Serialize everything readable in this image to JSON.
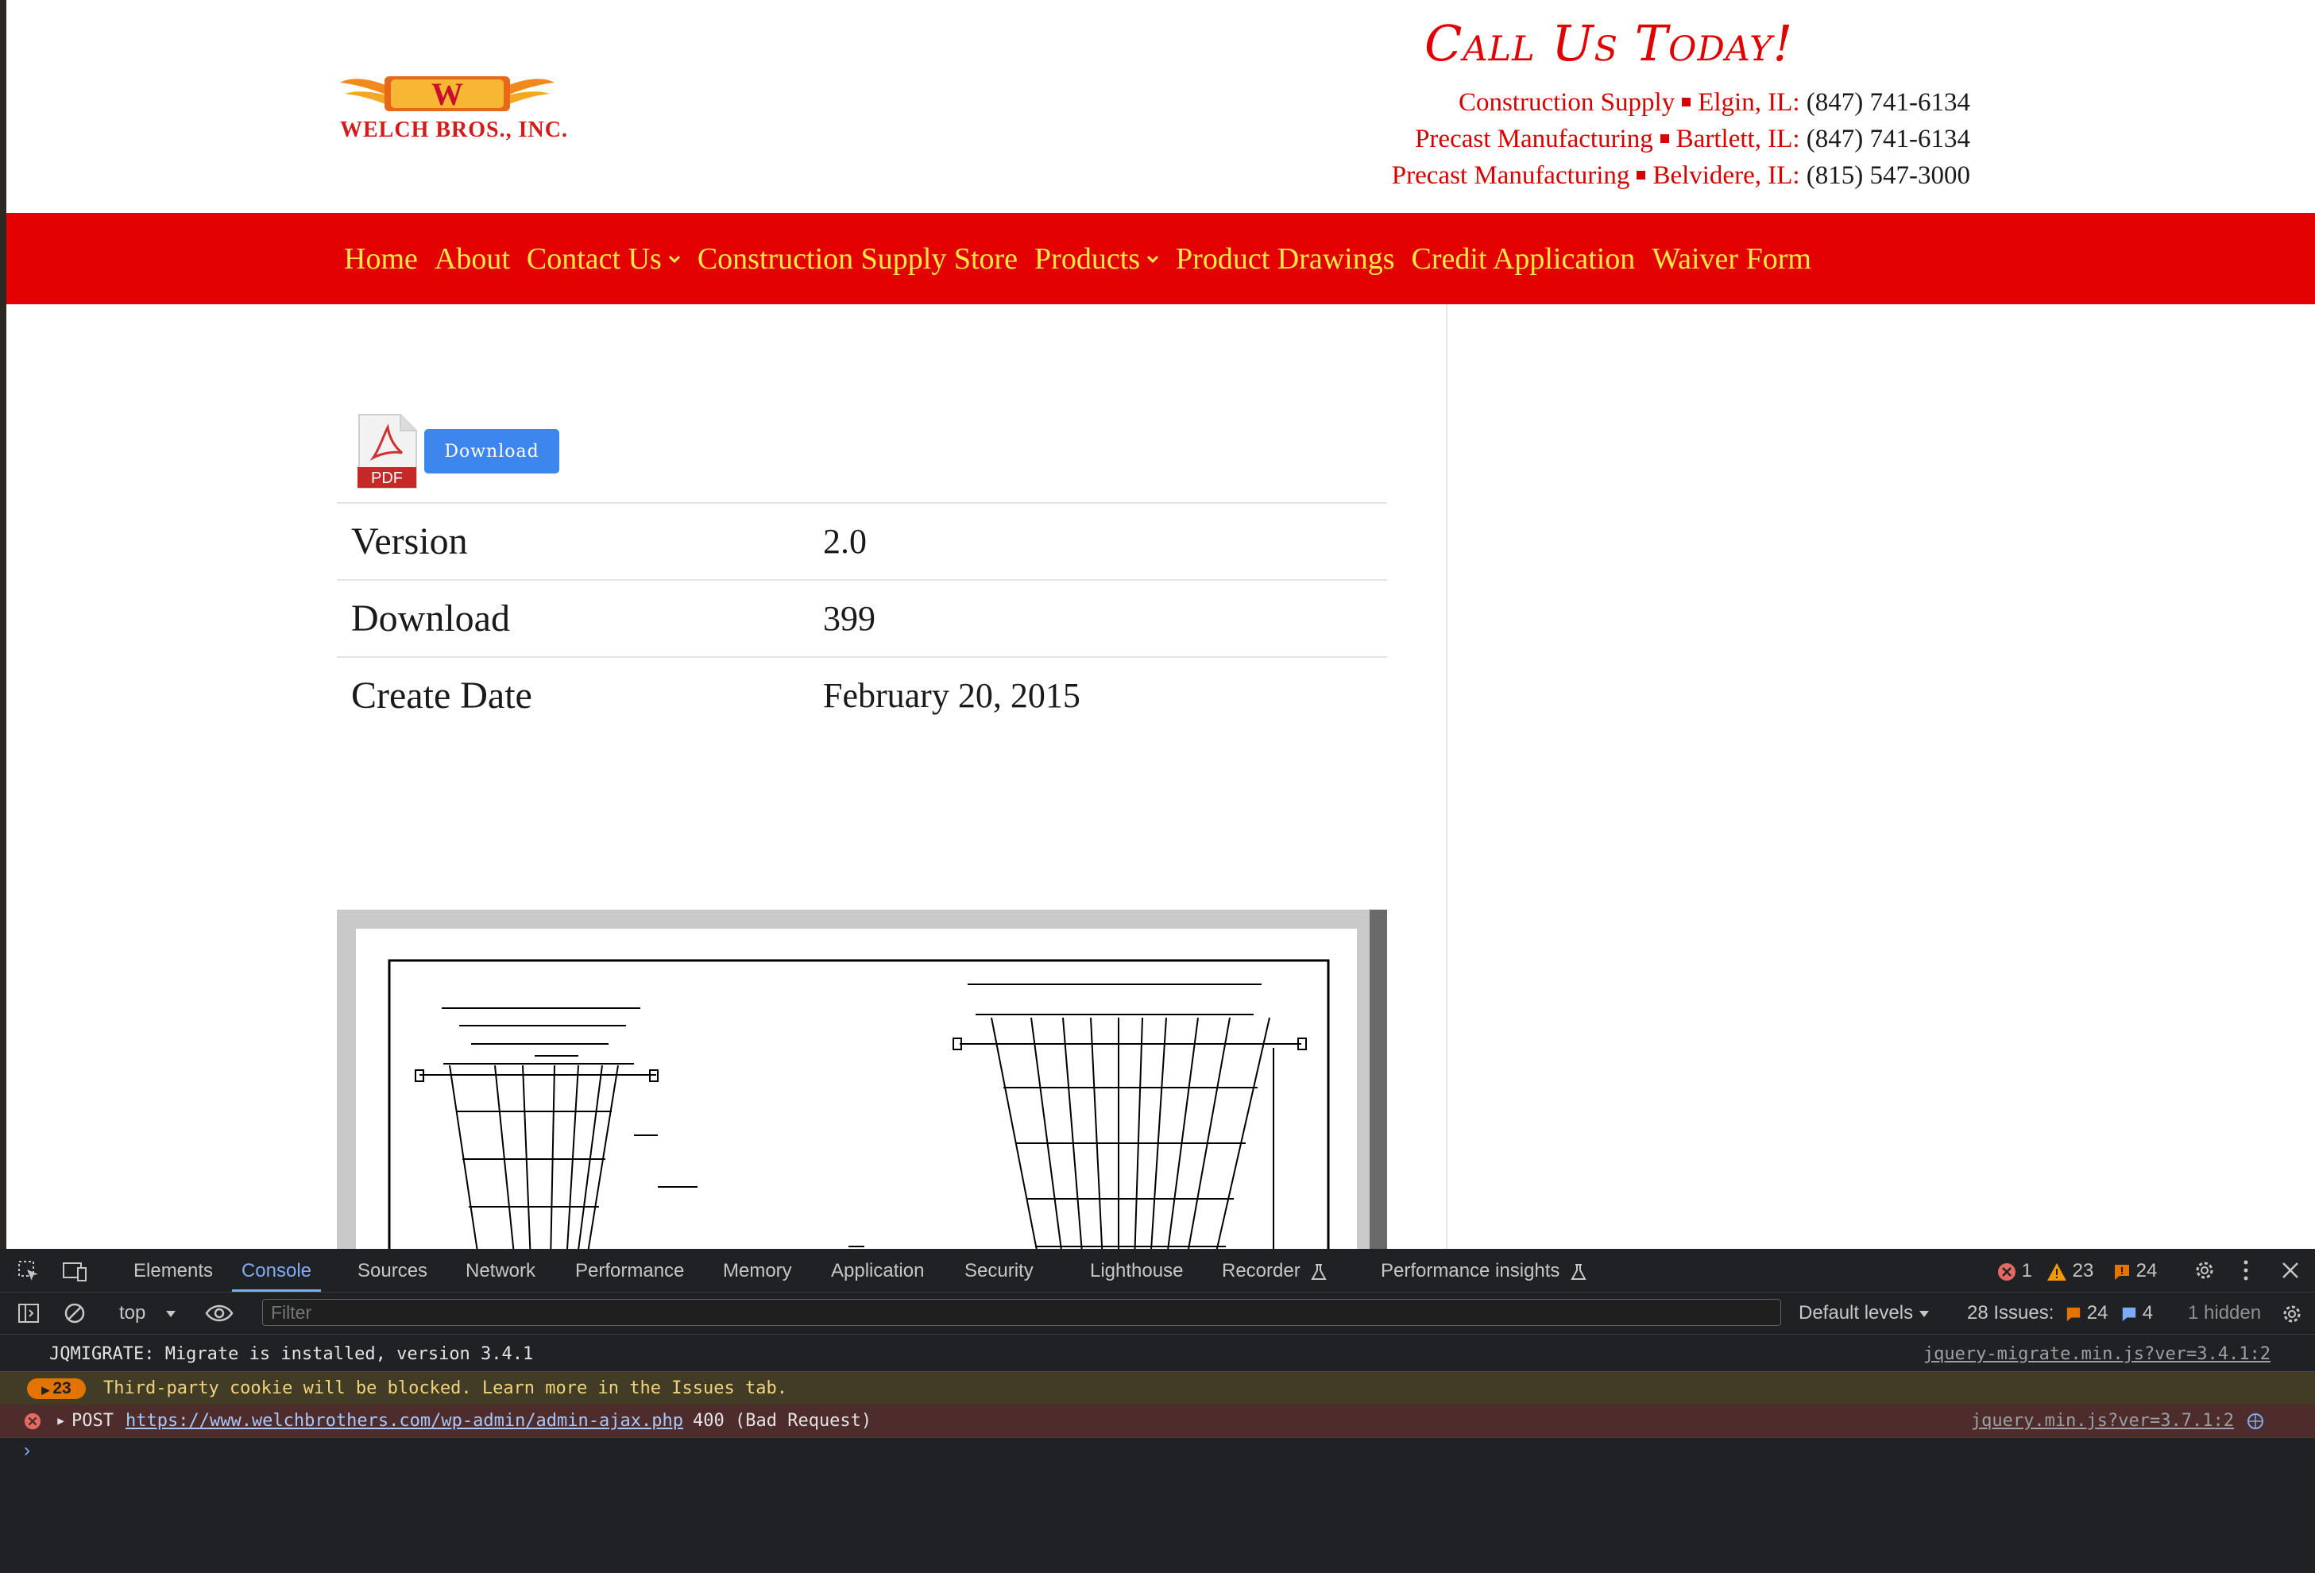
{
  "site": {
    "logo_text": "WELCH BROS., INC.",
    "logo_letter": "W",
    "call_us": "Call Us Today!",
    "contacts": [
      {
        "label": "Construction Supply",
        "location": "Elgin, IL:",
        "phone": "(847) 741-6134"
      },
      {
        "label": "Precast Manufacturing",
        "location": "Bartlett, IL:",
        "phone": "(847) 741-6134"
      },
      {
        "label": "Precast Manufacturing",
        "location": "Belvidere, IL:",
        "phone": "(815) 547-3000"
      }
    ],
    "nav": [
      {
        "label": "Home"
      },
      {
        "label": "About"
      },
      {
        "label": "Contact Us"
      },
      {
        "label": "Construction Supply Store"
      },
      {
        "label": "Products"
      },
      {
        "label": "Product Drawings"
      },
      {
        "label": "Credit Application"
      },
      {
        "label": "Waiver Form"
      }
    ]
  },
  "download": {
    "pdf_label": "PDF",
    "button_label": "Download",
    "rows": [
      {
        "key": "Version",
        "value": "2.0"
      },
      {
        "key": "Download",
        "value": "399"
      },
      {
        "key": "Create Date",
        "value": "February 20, 2015"
      }
    ]
  },
  "devtools": {
    "tabs": [
      "Elements",
      "Console",
      "Sources",
      "Network",
      "Performance",
      "Memory",
      "Application",
      "Security",
      "Lighthouse",
      "Recorder",
      "Performance insights"
    ],
    "active_tab": "Console",
    "error_count": "1",
    "warning_count": "23",
    "info_count": "24",
    "context": "top",
    "filter_placeholder": "Filter",
    "levels": "Default levels",
    "issues_label": "28 Issues:",
    "issues_warn": "24",
    "issues_info": "4",
    "hidden": "1 hidden",
    "logs": [
      {
        "text": "JQMIGRATE: Migrate is installed, version 3.4.1",
        "source": "jquery-migrate.min.js?ver=3.4.1:2"
      },
      {
        "count": "23",
        "text": "Third-party cookie will be blocked. Learn more in the Issues tab."
      },
      {
        "method": "POST",
        "url": "https://www.welchbrothers.com/wp-admin/admin-ajax.php",
        "status": "400 (Bad Request)",
        "source": "jquery.min.js?ver=3.7.1:2"
      }
    ],
    "prompt": "›"
  }
}
